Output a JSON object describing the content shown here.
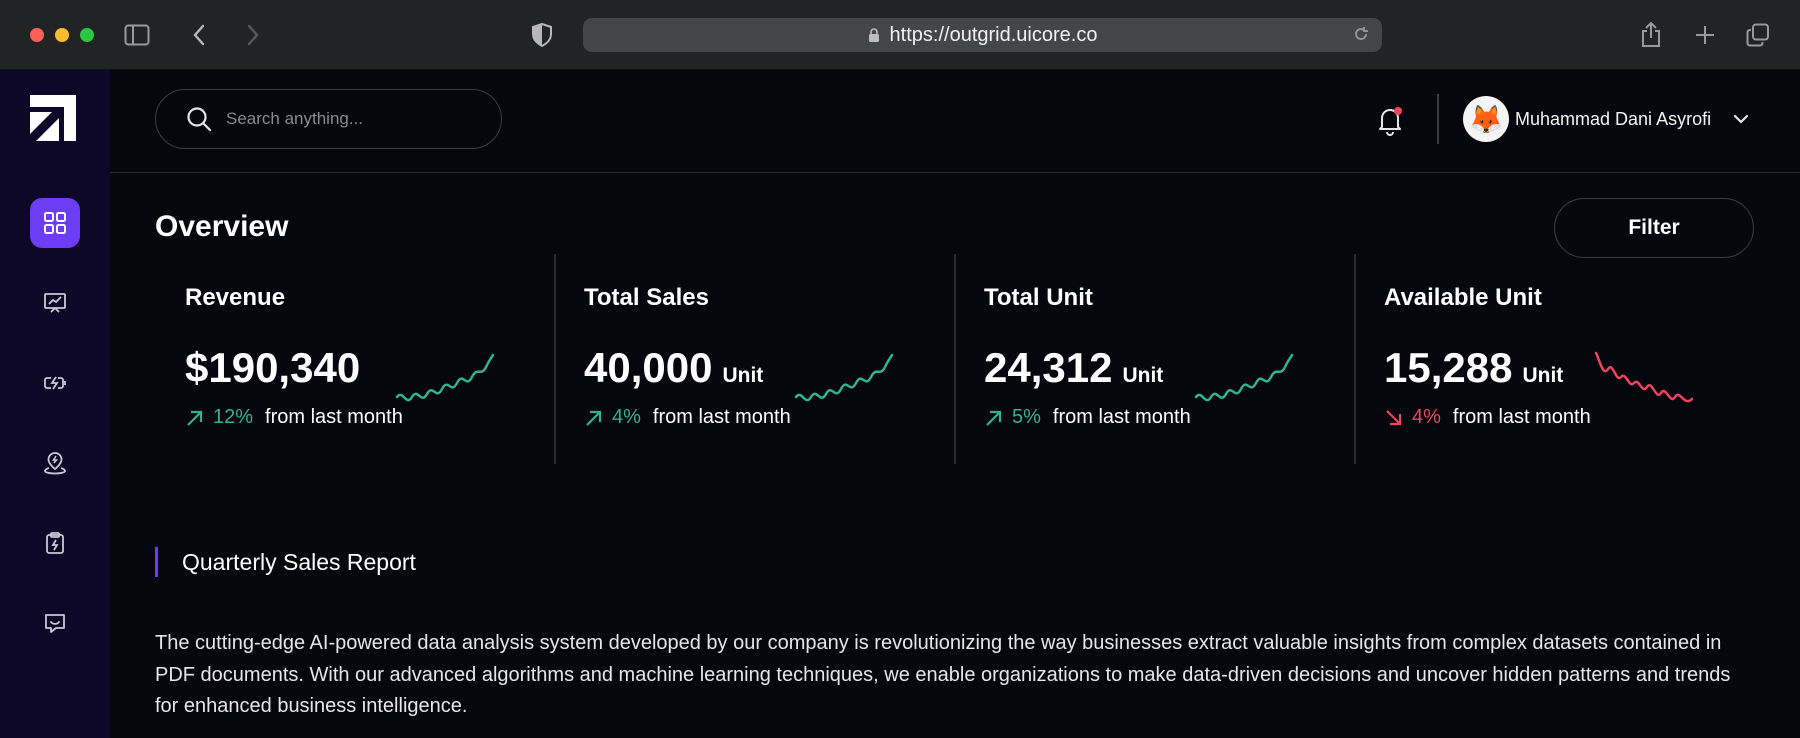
{
  "browser": {
    "url": "https://outgrid.uicore.co"
  },
  "sidebar": {
    "items": [
      {
        "icon": "grid-icon",
        "active": true
      },
      {
        "icon": "presentation-chart-icon",
        "active": false
      },
      {
        "icon": "battery-charge-icon",
        "active": false
      },
      {
        "icon": "location-pin-icon",
        "active": false
      },
      {
        "icon": "clipboard-bolt-icon",
        "active": false
      },
      {
        "icon": "chat-icon",
        "active": false
      }
    ]
  },
  "header": {
    "search_placeholder": "Search anything...",
    "user_name": "Muhammad Dani Asyrofi",
    "avatar_emoji": "🦊"
  },
  "overview": {
    "title": "Overview",
    "filter_label": "Filter"
  },
  "stats": [
    {
      "label": "Revenue",
      "value": "$190,340",
      "unit": "",
      "change": "12%",
      "direction": "up",
      "change_text": "from last month"
    },
    {
      "label": "Total Sales",
      "value": "40,000",
      "unit": "Unit",
      "change": "4%",
      "direction": "up",
      "change_text": "from last month"
    },
    {
      "label": "Total Unit",
      "value": "24,312",
      "unit": "Unit",
      "change": "5%",
      "direction": "up",
      "change_text": "from last month"
    },
    {
      "label": "Available Unit",
      "value": "15,288",
      "unit": "Unit",
      "change": "4%",
      "direction": "down",
      "change_text": "from last month"
    }
  ],
  "colors": {
    "accent": "#6c3df5",
    "positive": "#2fb58c",
    "negative": "#f0435d"
  },
  "report": {
    "title": "Quarterly Sales Report",
    "body": "The cutting-edge AI-powered data analysis system developed by our company is revolutionizing the way businesses extract valuable insights from complex datasets contained in PDF documents. With our advanced algorithms and machine learning techniques, we enable organizations to make data-driven decisions and uncover hidden patterns and trends for enhanced business intelligence."
  }
}
